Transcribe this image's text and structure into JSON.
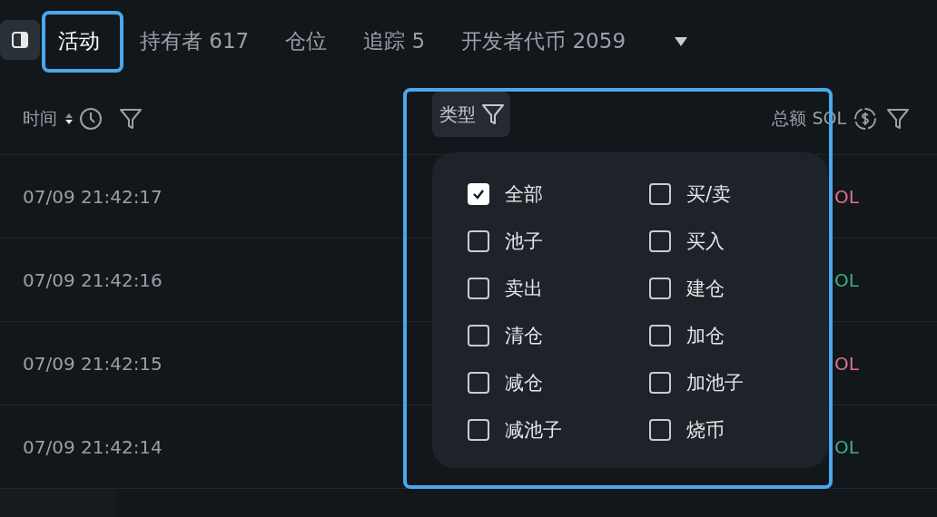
{
  "tabs": [
    {
      "label": "活动",
      "selected": true
    },
    {
      "label": "持有者 617",
      "selected": false
    },
    {
      "label": "仓位",
      "selected": false
    },
    {
      "label": "追踪 5",
      "selected": false
    },
    {
      "label": "开发者代币 2059",
      "selected": false
    }
  ],
  "table": {
    "columns": [
      {
        "label": "时间"
      },
      {
        "label": "类型"
      },
      {
        "label": "总额 SOL"
      }
    ],
    "rows": [
      {
        "time": "07/09 21:42:17",
        "amount": "OL",
        "color": "#e0708a"
      },
      {
        "time": "07/09 21:42:16",
        "amount": "OL",
        "color": "#3fae7c"
      },
      {
        "time": "07/09 21:42:15",
        "amount": "OL",
        "color": "#e0708a"
      },
      {
        "time": "07/09 21:42:14",
        "amount": "OL",
        "color": "#3fae7c"
      }
    ]
  },
  "type_filter": {
    "options": [
      {
        "label": "全部",
        "checked": true
      },
      {
        "label": "买/卖",
        "checked": false
      },
      {
        "label": "池子",
        "checked": false
      },
      {
        "label": "买入",
        "checked": false
      },
      {
        "label": "卖出",
        "checked": false
      },
      {
        "label": "建仓",
        "checked": false
      },
      {
        "label": "清仓",
        "checked": false
      },
      {
        "label": "加仓",
        "checked": false
      },
      {
        "label": "减仓",
        "checked": false
      },
      {
        "label": "加池子",
        "checked": false
      },
      {
        "label": "减池子",
        "checked": false
      },
      {
        "label": "烧币",
        "checked": false
      }
    ]
  }
}
